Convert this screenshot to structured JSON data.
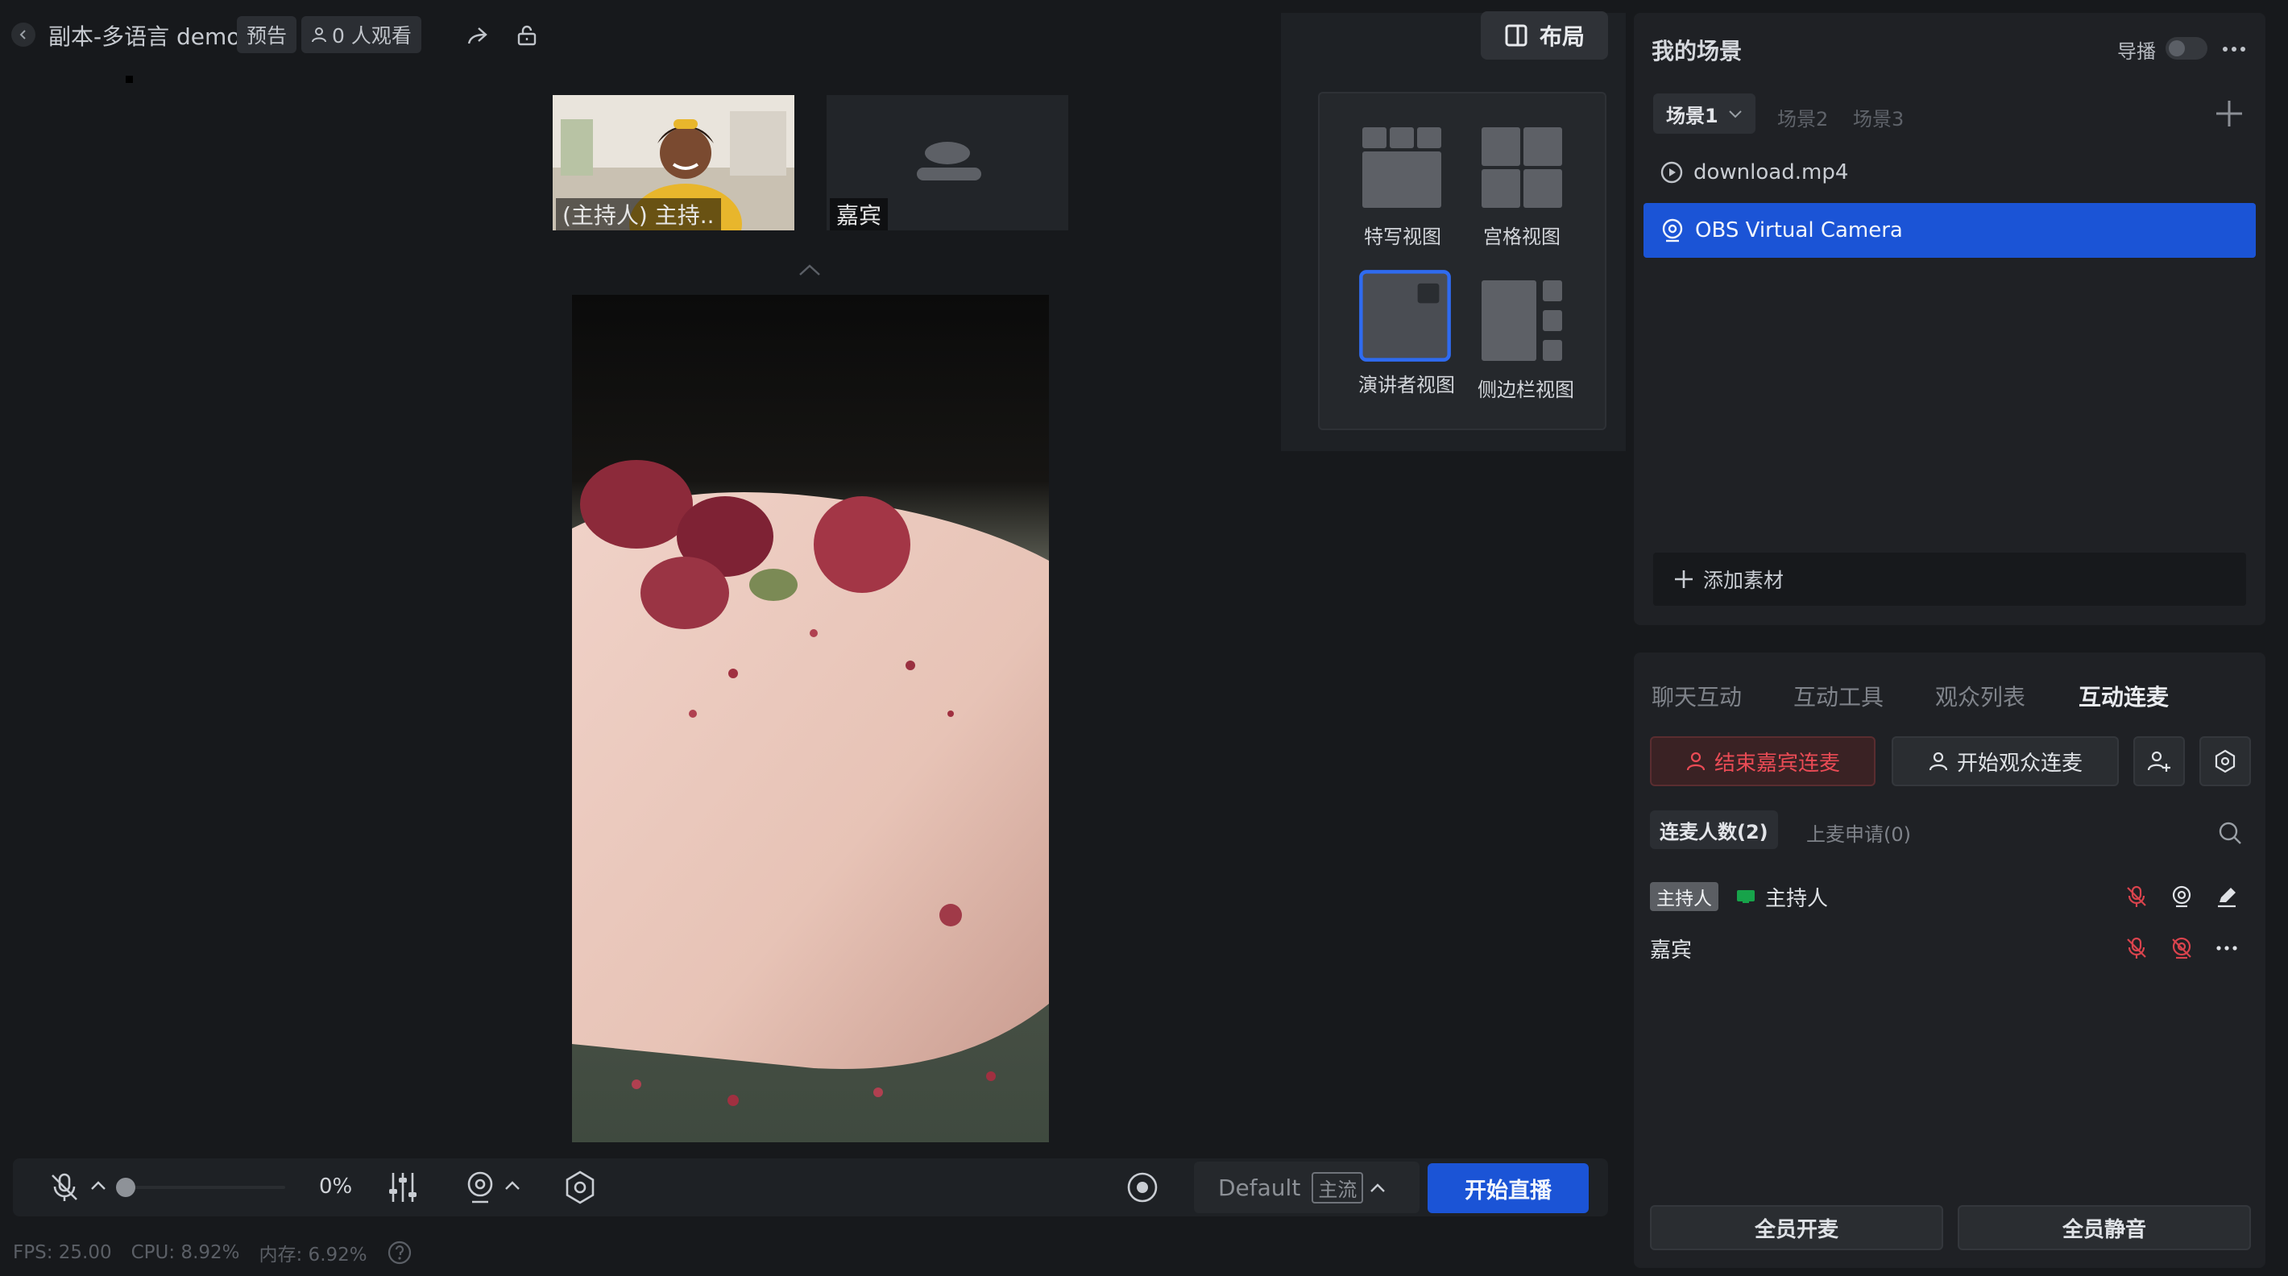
{
  "header": {
    "title": "副本-多语言 demo",
    "status_tag": "预告",
    "viewers": "0 人观看"
  },
  "thumbnails": [
    {
      "label": "(主持人) 主持.."
    },
    {
      "label": "嘉宾"
    }
  ],
  "layout": {
    "button_label": "布局",
    "options": [
      {
        "label": "特写视图"
      },
      {
        "label": "宫格视图"
      },
      {
        "label": "演讲者视图",
        "selected": true
      },
      {
        "label": "侧边栏视图"
      }
    ]
  },
  "scenes": {
    "title": "我的场景",
    "director_label": "导播",
    "tabs": [
      "场景1",
      "场景2",
      "场景3"
    ],
    "sources": [
      {
        "label": "download.mp4",
        "icon": "play-circle-icon"
      },
      {
        "label": "OBS Virtual Camera",
        "icon": "webcam-icon",
        "selected": true
      }
    ],
    "add_label": "添加素材"
  },
  "interaction": {
    "tabs": [
      "聊天互动",
      "互动工具",
      "观众列表",
      "互动连麦"
    ],
    "active_tab": "互动连麦",
    "end_guest_label": "结束嘉宾连麦",
    "start_audience_label": "开始观众连麦",
    "connected_label": "连麦人数(2)",
    "requests_label": "上麦申请(0)",
    "participants": [
      {
        "badge": "主持人",
        "name": "主持人"
      },
      {
        "name": "嘉宾"
      }
    ],
    "unmute_all": "全员开麦",
    "mute_all": "全员静音"
  },
  "controls": {
    "volume_percent": "0%",
    "stream_name": "Default",
    "stream_badge": "主流",
    "go_live": "开始直播"
  },
  "status": {
    "fps": "FPS: 25.00",
    "cpu": "CPU: 8.92%",
    "mem": "内存: 6.92%"
  },
  "colors": {
    "accent": "#1b54d6",
    "danger": "#ea4b55",
    "background": "#17191c"
  }
}
